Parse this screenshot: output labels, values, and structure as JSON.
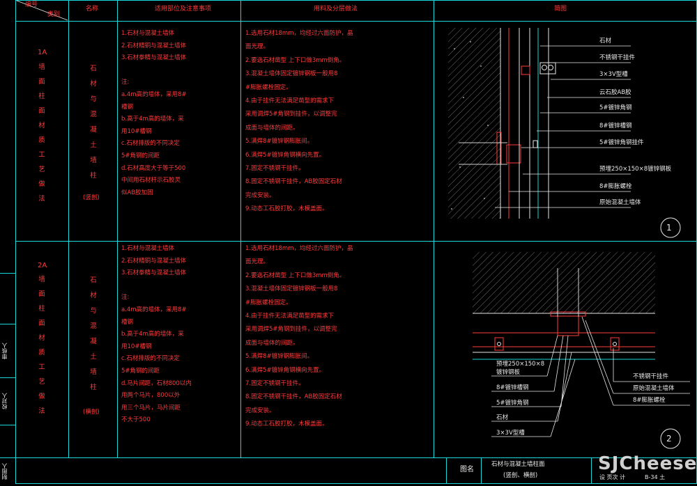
{
  "header": {
    "num": "编号",
    "category": "类别",
    "name": "名称",
    "scope": "适用部位及注意事项",
    "materials": "用料及分层做法",
    "diagram": "简图"
  },
  "rows": [
    {
      "code": "1A",
      "category": "墙面柱面材质工艺做法",
      "name": "石材与混凝土墙柱",
      "name_note": "(竖剖)",
      "scope": [
        "1.石材与混凝土墙体",
        "2.石材精铜与混凝土墙体",
        "3.石材拳精与混凝土墙体",
        "",
        "注:",
        "a.4m高的墙体，采用8#",
        "  槽钢",
        "b.高于4m高的墙体，采",
        "  用10#槽钢",
        "c.石材排版的不同决定",
        "  5#角钢的间距",
        "d.石材高度大于等于500",
        "  中间用石材杆示石胶灵",
        "  似AB胶加固"
      ],
      "materials": [
        "1.选用石材18mm，均经过六面防护，晶",
        "  面光理。",
        "2.要选石材凿型 上下口做3mm倒角。",
        "3.混凝土墙体固定镀锌钢板一般用8",
        "  #膨胀螺栓固定。",
        "4.由于挂件无法满足凿型的需求下",
        "  采用调焊5#角钢到挂件，以调整完",
        "  成面与墙体的间距。",
        "5.满焊8#镀锌钢膨胀间。",
        "6.满焊5#镀锌角钢横向先置。",
        "7.固定不锈钢干挂件。",
        "8.固定不锈钢干挂件，AB胶固定石材",
        "  完成安装。",
        "9.动态工石胶打胶，木模盖面。"
      ],
      "labels": [
        "石材",
        "不锈钢干挂件",
        "3×3V型槽",
        "云石胶AB胶",
        "5#镀锌角钢",
        "8#镀锌槽钢",
        "5#镀锌角钢挂件",
        "预埋250×150×8镀锌钢板",
        "8#膨胀螺栓",
        "原始混凝土墙体"
      ],
      "circle": "1"
    },
    {
      "code": "2A",
      "category": "墙面柱面材质工艺做法",
      "name": "石材与混凝土墙柱",
      "name_note": "(横剖)",
      "scope": [
        "1.石材与混凝土墙体",
        "2.石材精铜与混凝土墙体",
        "3.石材拳精与混凝土墙体",
        "",
        "注:",
        "a.4m高的墙体，采用8#",
        "  槽钢",
        "b.高于4m高的墙体，采",
        "  用10#槽钢",
        "c.石材排版的不同决定",
        "  5#角钢的间距",
        "d.马片间距，石材800以内",
        "  用两个马片，800以外",
        "  用三个马片，马片间距",
        "  不大于500"
      ],
      "materials": [
        "1.选用石材18mm，均经过六面防护，晶",
        "  面光理。",
        "2.要选石材凿型 上下口做3mm倒角。",
        "3.混凝土墙体固定镀锌钢板一般用8",
        "  #膨胀螺栓固定。",
        "4.由于挂件无法满足凿型的需求下",
        "  采用调焊5#角钢到挂件，以调整完",
        "  成面与墙体的间距。",
        "5.满焊8#镀锌钢膨胀间。",
        "6.满焊5#镀锌角钢横向先置。",
        "7.固定不锈钢干挂件。",
        "8.固定不锈钢干挂件，AB胶固定石材",
        "  完成安装。",
        "9.动态工石胶打胶，木模盖面。"
      ],
      "labels_left": [
        "预埋250×150×8",
        "镀锌钢板",
        "8#镀锌槽钢",
        "5#镀锌角钢",
        "石材",
        "3×3V型槽"
      ],
      "labels_right": [
        "不锈钢干挂件",
        "原始混凝土墙体",
        "8#膨胀螺栓"
      ],
      "circle": "2"
    }
  ],
  "sidebar": [
    "审核人",
    "校对人",
    "制图人"
  ],
  "titleblock": {
    "label": "图名",
    "title1": "石材与混凝土墙柱面",
    "title2": "(竖剖、横剖)",
    "sub": "设 页次 计",
    "page": "B-34  土"
  },
  "watermark": "SJCheese"
}
